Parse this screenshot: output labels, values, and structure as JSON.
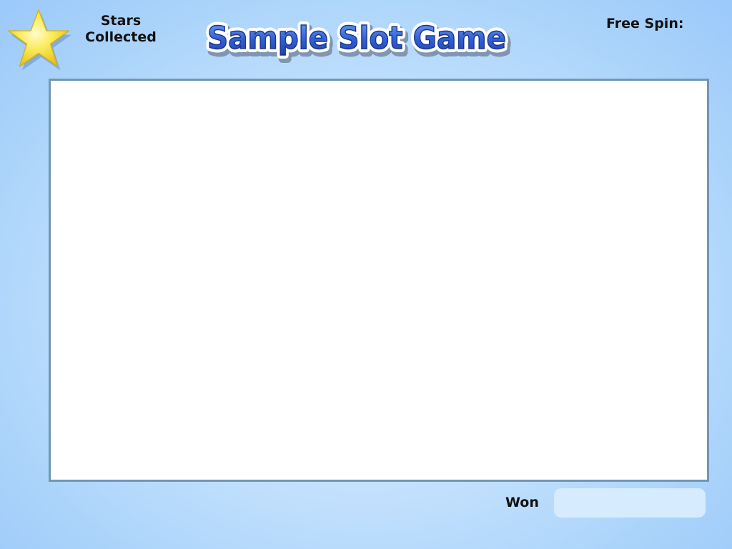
{
  "header": {
    "stars_label_line1": "Stars",
    "stars_label_line2": "Collected",
    "title": "Sample Slot Game",
    "free_spin_label": "Free Spin:"
  },
  "footer": {
    "won_label": "Won",
    "won_value": ""
  },
  "icons": {
    "star": "star-icon"
  },
  "colors": {
    "background": "#b4d9fb",
    "reel_border": "#7196b6",
    "title_fill": "#2f58c8",
    "star_fill": "#f9e43a"
  }
}
